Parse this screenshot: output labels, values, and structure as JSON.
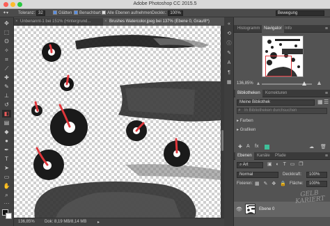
{
  "app_title": "Adobe Photoshop CC 2015.5",
  "options": {
    "tolerance_label": "Toleranz:",
    "tolerance_value": "32",
    "smooth_label": "Glätten",
    "contiguous_label": "Benachbart",
    "all_layers_label": "Alle Ebenen aufnehmen",
    "opacity_label": "Deckkr.:",
    "opacity_value": "100%",
    "workspace_value": "Bewegung"
  },
  "tabs": [
    {
      "label": "Unbenannt-1 bei 151% (Hintergrund...",
      "active": false
    },
    {
      "label": "Brushes Watercolor.jpeg bei 137% (Ebene 0, Grau/8*)",
      "active": true
    }
  ],
  "status": {
    "zoom": "136,85%",
    "doc": "Dok: 8,19 MB/8,14 MB"
  },
  "navigator_panel": {
    "tabs": [
      "Histogramm",
      "Navigator",
      "Info"
    ],
    "active_tab": "Navigator",
    "zoom": "136,85%"
  },
  "library_panel": {
    "tabs": [
      "Bibliotheken",
      "Korrekturen"
    ],
    "active_tab": "Bibliotheken",
    "library": "Meine Bibliothek",
    "search_placeholder": "In Bibliotheken durchsuchen",
    "groups": [
      "Farben",
      "Grafiken"
    ]
  },
  "layers_panel": {
    "tabs": [
      "Ebenen",
      "Kanäle",
      "Pfade"
    ],
    "active_tab": "Ebenen",
    "filter": "Art",
    "blend_mode": "Normal",
    "opacity_label": "Deckkraft:",
    "opacity_value": "100%",
    "lock_label": "Fixieren:",
    "fill_label": "Fläche:",
    "fill_value": "100%",
    "layer_name": "Ebene 0"
  },
  "watermark": "GELB KARIERT",
  "colors": {
    "accent_red": "#e0363b",
    "ink": "#1c1c1c",
    "panel_bg": "#535353",
    "select_blue": "#5a8ee0"
  }
}
